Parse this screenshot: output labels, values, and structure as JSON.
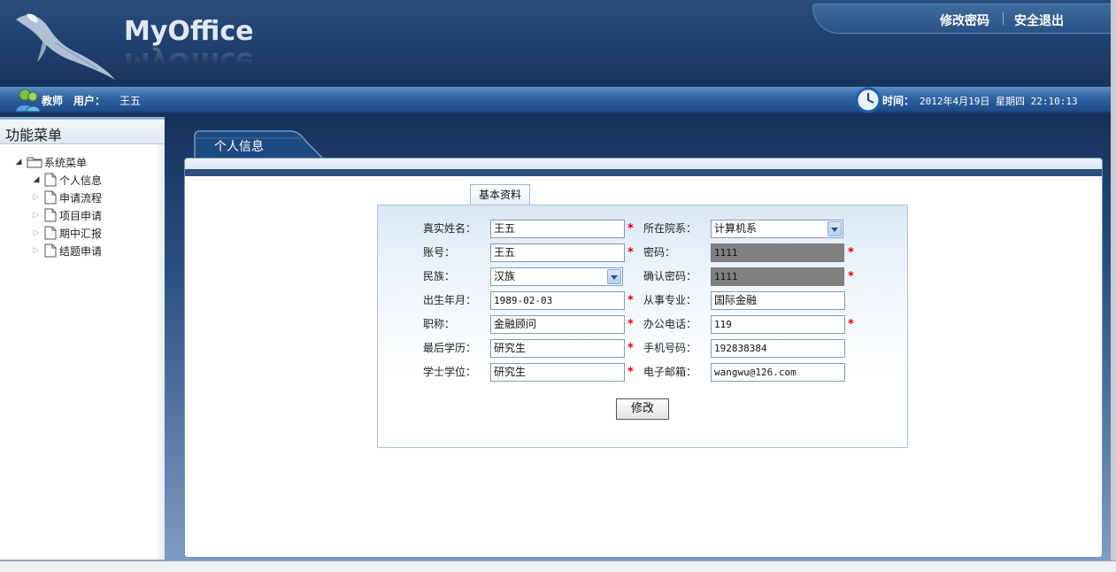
{
  "header": {
    "logo_text": "MyOffice",
    "links": {
      "change_password": "修改密码",
      "logout": "安全退出"
    }
  },
  "userbar": {
    "role": "教师",
    "user_label": "用户：",
    "user_name": "王五",
    "time_label": "时间：",
    "time_value": "2012年4月19日 星期四 22:10:13"
  },
  "sidebar": {
    "title": "功能菜单",
    "root": "系统菜单",
    "items": [
      {
        "label": "个人信息",
        "expanded": true
      },
      {
        "label": "申请流程",
        "expanded": false
      },
      {
        "label": "项目申请",
        "expanded": false
      },
      {
        "label": "期中汇报",
        "expanded": false
      },
      {
        "label": "结题申请",
        "expanded": false
      }
    ]
  },
  "main": {
    "tab": "个人信息",
    "subtab": "基本资料",
    "form": {
      "real_name_label": "真实姓名：",
      "real_name": "王五",
      "account_label": "账号：",
      "account": "王五",
      "ethnicity_label": "民族：",
      "ethnicity": "汉族",
      "birth_label": "出生年月：",
      "birth": "1989-02-03",
      "title_label": "职称：",
      "title": "金融顾问",
      "education_label": "最后学历：",
      "education": "研究生",
      "degree_label": "学士学位：",
      "degree": "研究生",
      "dept_label": "所在院系：",
      "dept": "计算机系",
      "password_label": "密码：",
      "password": "1111",
      "confirm_label": "确认密码：",
      "confirm": "1111",
      "major_label": "从事专业：",
      "major": "国际金融",
      "office_phone_label": "办公电话：",
      "office_phone": "119",
      "mobile_label": "手机号码：",
      "mobile": "192838384",
      "email_label": "电子邮箱：",
      "email": "wangwu@126.com",
      "required_mark": "*",
      "submit": "修改"
    }
  },
  "colors": {
    "header_bg": "#1f3f6c",
    "userbar_bg": "#2f62a0",
    "required": "#e00000",
    "password_bg": "#808080"
  },
  "icons": {
    "logo": "bird-logo-icon",
    "user": "user-avatar-icon",
    "clock": "clock-icon",
    "folder": "folder-icon",
    "page": "page-icon"
  }
}
